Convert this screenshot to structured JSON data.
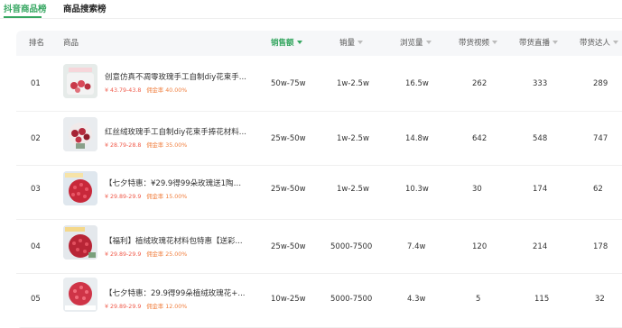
{
  "tabs": [
    {
      "label": "抖音商品榜"
    },
    {
      "label": "商品搜索榜"
    }
  ],
  "table": {
    "headers": {
      "rank": "排名",
      "product": "商品",
      "sales_amount": "销售额",
      "sales_volume": "销量",
      "views": "浏览量",
      "videos": "带货视频",
      "live": "带货直播",
      "influencers": "带货达人"
    },
    "sorted_column": "sales_amount",
    "rows": [
      {
        "rank": "01",
        "name": "创意仿真不凋零玫瑰手工自制diy花束手...",
        "price": "¥ 43.79-43.8",
        "commission": "佣金率 40.00%",
        "sales_amount": "50w-75w",
        "sales_volume": "1w-2.5w",
        "views": "16.5w",
        "videos": "262",
        "live": "333",
        "influencers": "289"
      },
      {
        "rank": "02",
        "name": "红丝绒玫瑰手工自制diy花束手捧花材料...",
        "price": "¥ 28.79-28.8",
        "commission": "佣金率 35.00%",
        "sales_amount": "25w-50w",
        "sales_volume": "1w-2.5w",
        "views": "14.8w",
        "videos": "642",
        "live": "548",
        "influencers": "747"
      },
      {
        "rank": "03",
        "name": "【七夕特惠：¥29.9得99朵玫瑰送1陶瓷...",
        "price": "¥ 29.89-29.9",
        "commission": "佣金率 15.00%",
        "sales_amount": "25w-50w",
        "sales_volume": "1w-2.5w",
        "views": "10.3w",
        "videos": "30",
        "live": "174",
        "influencers": "62"
      },
      {
        "rank": "04",
        "name": "【福利】植绒玫瑰花材料包特惠【送彩...",
        "price": "¥ 29.89-29.9",
        "commission": "佣金率 25.00%",
        "sales_amount": "25w-50w",
        "sales_volume": "5000-7500",
        "views": "7.4w",
        "videos": "120",
        "live": "214",
        "influencers": "178"
      },
      {
        "rank": "05",
        "name": "【七夕特惠：29.9得99朵植绒玫瑰花+...",
        "price": "¥ 29.89-29.9",
        "commission": "佣金率 12.00%",
        "sales_amount": "10w-25w",
        "sales_volume": "5000-7500",
        "views": "4.3w",
        "videos": "5",
        "live": "115",
        "influencers": "32"
      }
    ]
  },
  "colors": {
    "accent": "#35a660",
    "price": "#f05a4a",
    "commission": "#f07d3c",
    "header_bg": "#f6f7f9"
  }
}
